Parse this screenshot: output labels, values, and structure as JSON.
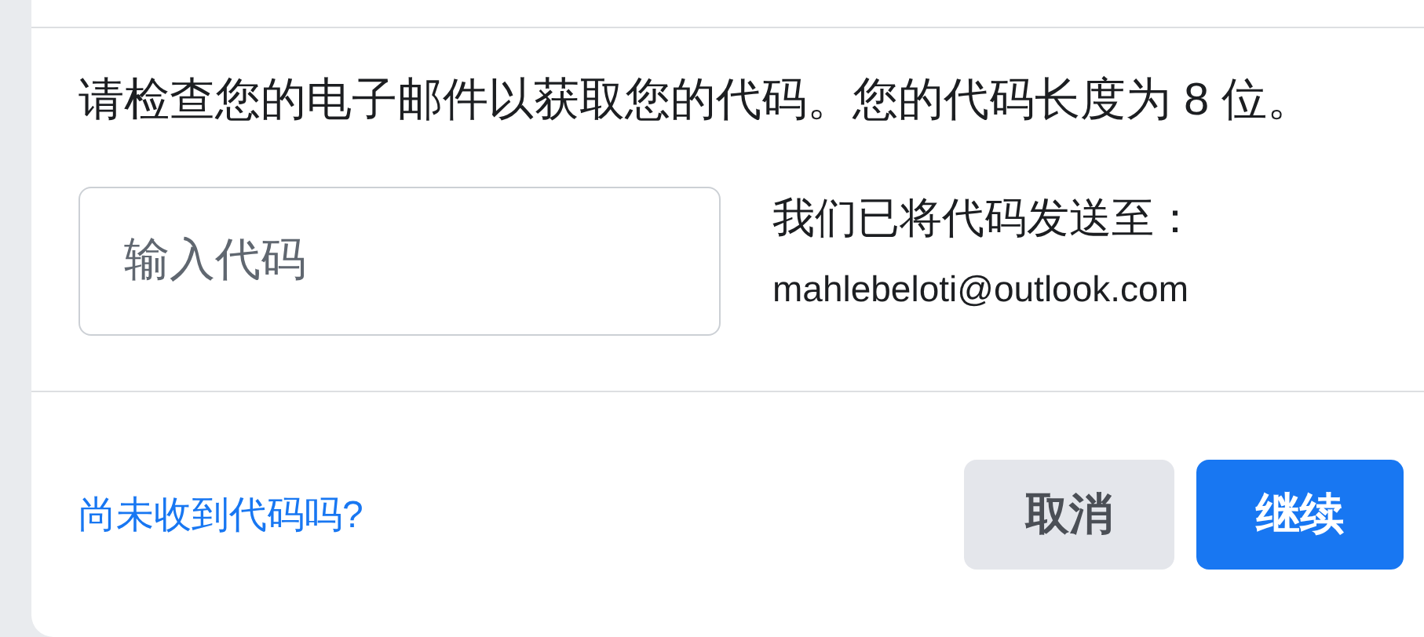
{
  "message": "请检查您的电子邮件以获取您的代码。您的代码长度为 8 位。",
  "code_field": {
    "placeholder": "输入代码"
  },
  "sent_to": {
    "label": "我们已将代码发送至：",
    "email": "mahlebeloti@outlook.com"
  },
  "footer": {
    "link": "尚未收到代码吗?",
    "buttons": [
      {
        "label": "取消",
        "kind": "secondary"
      },
      {
        "label": "继续",
        "kind": "primary"
      }
    ]
  }
}
